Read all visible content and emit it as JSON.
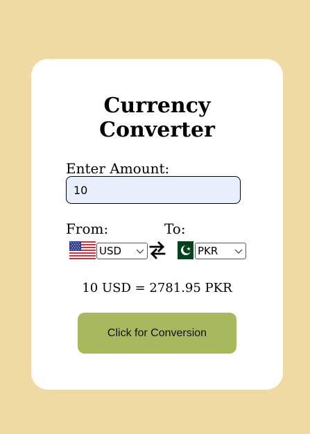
{
  "app": {
    "title": "Currency Converter",
    "colors": {
      "background": "#EFDAA3",
      "card": "#FFFFFF",
      "input_bg": "#E8EEFC",
      "button": "#A8B85E"
    }
  },
  "amount": {
    "label": "Enter Amount:",
    "value": "10"
  },
  "from": {
    "label": "From:",
    "currency": "USD",
    "flag_icon": "us-flag-icon"
  },
  "to": {
    "label": "To:",
    "currency": "PKR",
    "flag_icon": "pk-flag-icon"
  },
  "swap_icon": "swap-arrows-icon",
  "result": {
    "text": "10 USD = 2781.95 PKR"
  },
  "convert_button": {
    "label": "Click for Conversion"
  }
}
